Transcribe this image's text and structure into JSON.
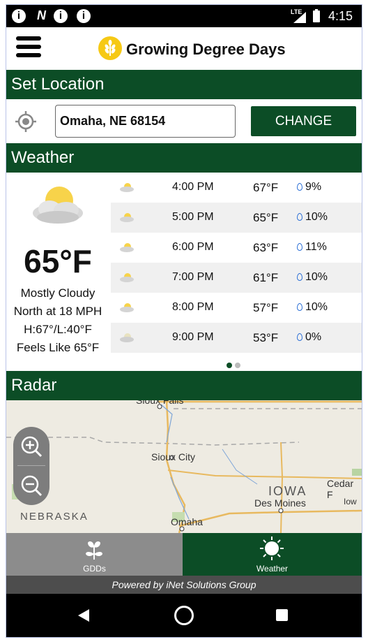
{
  "status_bar": {
    "time": "4:15",
    "network": "LTE"
  },
  "app": {
    "title": "Growing Degree Days"
  },
  "location": {
    "header": "Set Location",
    "value": "Omaha, NE 68154",
    "button": "CHANGE"
  },
  "weather": {
    "header": "Weather",
    "current": {
      "temp": "65°F",
      "condition": "Mostly Cloudy",
      "wind": "North at 18 MPH",
      "high_low": "H:67°/L:40°F",
      "feels_like": "Feels Like 65°F"
    },
    "hourly": [
      {
        "time": "4:00 PM",
        "temp": "67°F",
        "precip": "9%"
      },
      {
        "time": "5:00 PM",
        "temp": "65°F",
        "precip": "10%"
      },
      {
        "time": "6:00 PM",
        "temp": "63°F",
        "precip": "11%"
      },
      {
        "time": "7:00 PM",
        "temp": "61°F",
        "precip": "10%"
      },
      {
        "time": "8:00 PM",
        "temp": "57°F",
        "precip": "10%"
      },
      {
        "time": "9:00 PM",
        "temp": "53°F",
        "precip": "0%"
      }
    ],
    "page_dots": {
      "active": 0,
      "count": 2
    }
  },
  "radar": {
    "header": "Radar",
    "labels": {
      "sioux_falls": "Sioux Falls",
      "sioux_city": "Sioux City",
      "iowa": "IOWA",
      "des_moines": "Des Moines",
      "cedar": "Cedar F",
      "iow": "Iow",
      "nebraska": "NEBRASKA",
      "omaha": "Omaha"
    }
  },
  "bottom_nav": {
    "gdds": "GDDs",
    "weather": "Weather"
  },
  "footer": {
    "powered_by": "Powered by iNet Solutions Group"
  },
  "colors": {
    "brand_green": "#0c4d26",
    "logo_yellow": "#f6c915",
    "nav_gray": "#8c8c8c"
  }
}
